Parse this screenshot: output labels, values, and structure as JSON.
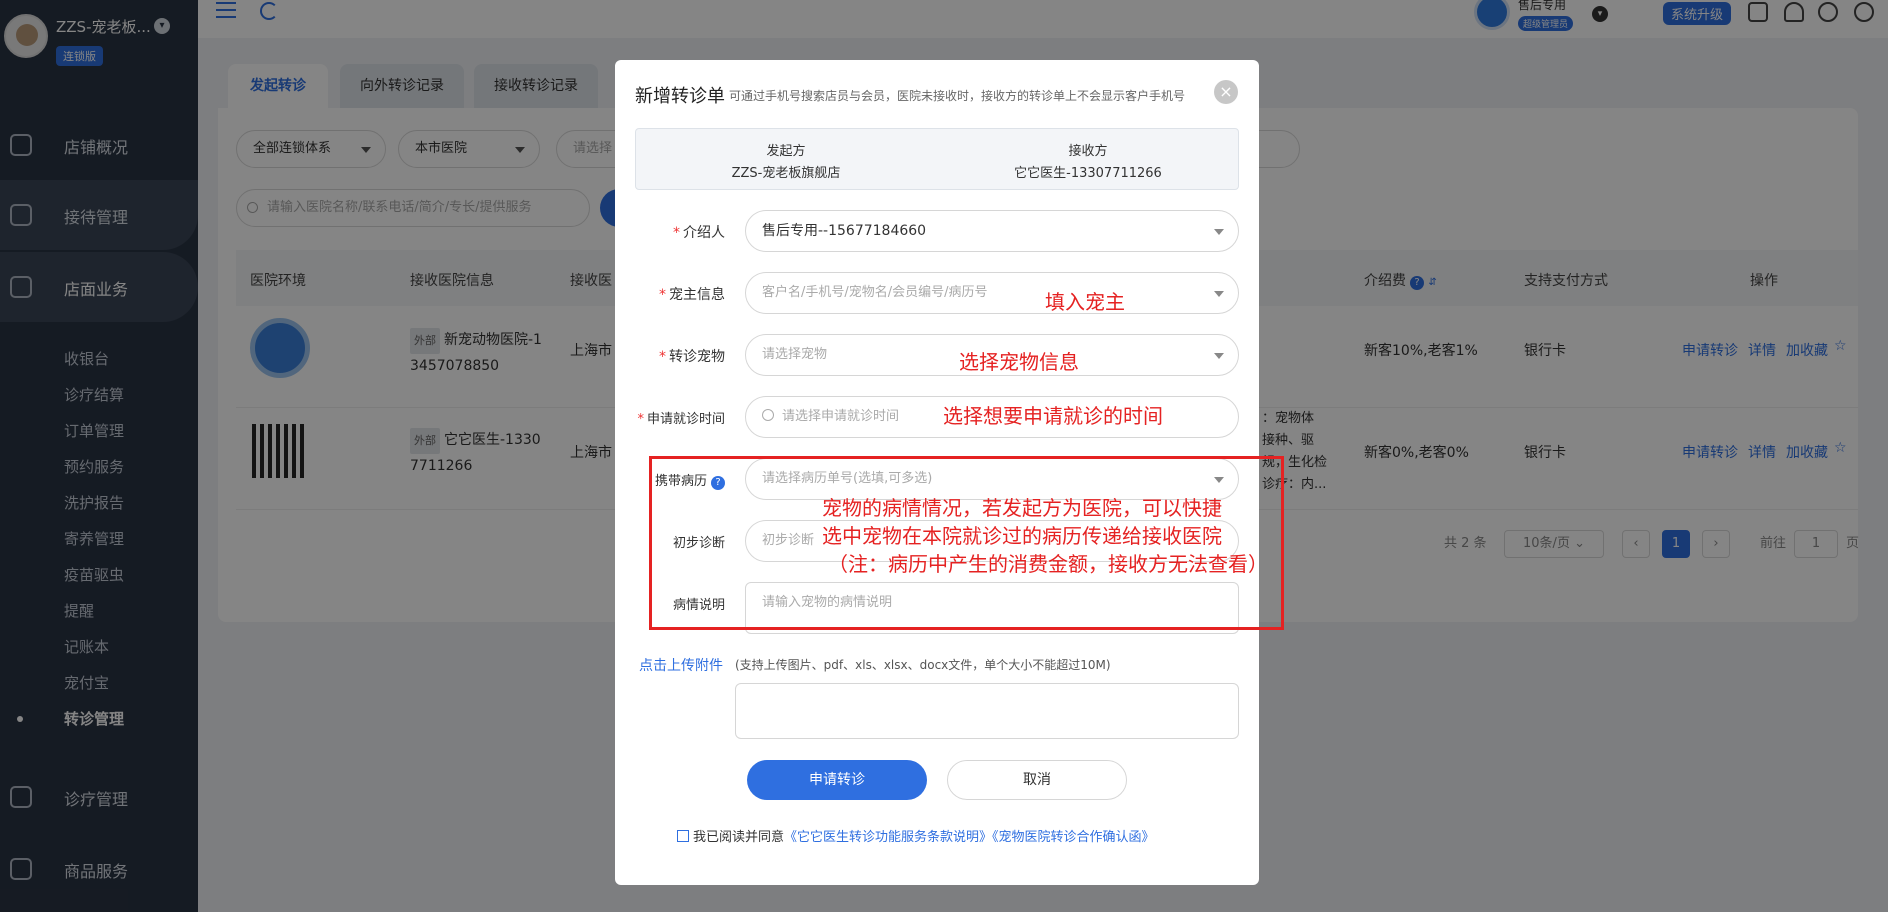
{
  "brand": {
    "name": "ZZS-宠老板...",
    "badge": "连锁版"
  },
  "nav": {
    "main": [
      "店铺概况",
      "接待管理",
      "店面业务",
      "诊疗管理",
      "商品服务"
    ],
    "sub": [
      "收银台",
      "诊疗结算",
      "订单管理",
      "预约服务",
      "洗护报告",
      "寄养管理",
      "疫苗驱虫",
      "提醒",
      "记账本",
      "宠付宝",
      "转诊管理"
    ]
  },
  "topbar": {
    "user_name": "售后专用",
    "user_role": "超级管理员",
    "upgrade": "系统升级"
  },
  "tabs": [
    "发起转诊",
    "向外转诊记录",
    "接收转诊记录"
  ],
  "filters": {
    "chain": "全部连锁体系",
    "city": "本市医院",
    "third": "请选择",
    "search_placeholder": "请输入医院名称/联系电话/简介/专长/提供服务"
  },
  "table": {
    "headers": [
      "医院环境",
      "接收医院信息",
      "接收医",
      "介绍费",
      "支持支付方式",
      "操作"
    ],
    "rows": [
      {
        "tag": "外部",
        "name_line1": "新宠动物医院-1",
        "name_line2": "3457078850",
        "addr": "上海市",
        "extra1": "",
        "extra2": "",
        "extra3": "",
        "fee": "新客10%,老客1%",
        "pay": "银行卡"
      },
      {
        "tag": "外部",
        "name_line1": "它它医生-1330",
        "name_line2": "7711266",
        "addr": "上海市",
        "extra1": "：宠物体",
        "extra2": "接种、驱",
        "extra3": "规，生化检",
        "extra4": "诊疗：内...",
        "fee": "新客0%,老客0%",
        "pay": "银行卡"
      }
    ],
    "actions": [
      "申请转诊",
      "详情",
      "加收藏"
    ]
  },
  "pager": {
    "total": "共 2 条",
    "size": "10条/页",
    "current": "1",
    "goto": "前往",
    "goto_value": "1",
    "unit": "页"
  },
  "modal": {
    "title": "新增转诊单",
    "subtitle": "可通过手机号搜索店员与会员，医院未接收时，接收方的转诊单上不会显示客户手机号",
    "from_label": "发起方",
    "from_value": "ZZS-宠老板旗舰店",
    "to_label": "接收方",
    "to_value": "它它医生-13307711266",
    "fields": {
      "referrer_label": "介绍人",
      "referrer_value": "售后专用--15677184660",
      "owner_label": "宠主信息",
      "owner_placeholder": "客户名/手机号/宠物名/会员编号/病历号",
      "pet_label": "转诊宠物",
      "pet_placeholder": "请选择宠物",
      "time_label": "申请就诊时间",
      "time_placeholder": "请选择申请就诊时间",
      "records_label": "携带病历",
      "records_placeholder": "请选择病历单号(选填,可多选)",
      "diag_label": "初步诊断",
      "diag_placeholder": "初步诊断",
      "desc_label": "病情说明",
      "desc_placeholder": "请输入宠物的病情说明"
    },
    "upload_link": "点击上传附件",
    "upload_hint": "(支持上传图片、pdf、xls、xlsx、docx文件，单个大小不能超过10M)",
    "submit": "申请转诊",
    "cancel": "取消",
    "agree_text": "我已阅读并同意",
    "agree_link1": "《它它医生转诊功能服务条款说明》",
    "agree_link2": "《宠物医院转诊合作确认函》"
  },
  "annotations": {
    "owner": "填入宠主",
    "pet": "选择宠物信息",
    "time": "选择想要申请就诊的时间",
    "line1": "宠物的病情情况，若发起方为医院，可以快捷",
    "line2": "选中宠物在本院就诊过的病历传递给接收医院",
    "line3": "（注：病历中产生的消费金额，接收方无法查看）"
  },
  "colors": {
    "primary": "#2f6fe0",
    "sidebar": "#2a3444",
    "annotation": "#e52222"
  }
}
